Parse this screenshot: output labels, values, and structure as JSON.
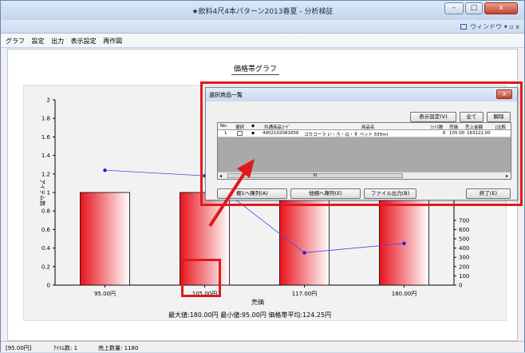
{
  "window": {
    "title": "★飲料4尺4本パターン2013春夏 - 分析検証",
    "buttons": [
      "–",
      "□",
      "x"
    ]
  },
  "mdi": {
    "window_menu": "ウィンドウ ▾  ▫  x"
  },
  "menu": {
    "items": [
      "グラフ",
      "設定",
      "出力",
      "表示設定",
      "再作図"
    ]
  },
  "chart_title": "価格帯グラフ",
  "chart_data": {
    "type": "bar",
    "categories": [
      "95.00円",
      "105.00円",
      "117.00円",
      "180.00円"
    ],
    "bar_series": {
      "name": "アイテム数",
      "values": [
        1,
        1,
        1,
        1
      ]
    },
    "line_series": {
      "name": "売上数量",
      "values": [
        1240,
        1180,
        350,
        450
      ]
    },
    "ylabel_left": "アイテム数",
    "ylim_left": [
      0,
      2
    ],
    "yticks_left": [
      "0",
      "0.2",
      "0.4",
      "0.6",
      "0.8",
      "1",
      "1.2",
      "1.4",
      "1.6",
      "1.8",
      "2"
    ],
    "ylim_right": [
      0,
      2000
    ],
    "yticks_right": [
      "0",
      "100",
      "200",
      "300",
      "400",
      "500",
      "600",
      "700"
    ],
    "xlabel": "売価",
    "colors": {
      "bar": "#e8121b",
      "line": "#4a4ae0"
    }
  },
  "stats_line": "最大値:180.00円  最小値:95.00円  価格帯平均:124.25円",
  "status": {
    "price": "[95.00円]",
    "items": "ｱｲﾃﾑ数: 1",
    "qty": "売上数量: 1180"
  },
  "dialog": {
    "title": "選択商品一覧",
    "close": "x",
    "top_buttons": [
      "表示設定(V)",
      "全て",
      "解除"
    ],
    "headers": [
      "No.",
      "選択",
      "◆",
      "共通商品ｺｰﾄﾞ",
      "商品名",
      "ﾌｪｲｽ数",
      "売価",
      "売上金額",
      "[比較"
    ],
    "rows": [
      [
        "1",
        "",
        "◆",
        "4902102081656",
        "コカコーラ い・ろ・は・す ペット 555ml",
        "6",
        "105.00",
        "163122.00",
        ""
      ]
    ],
    "scroll_thumb": "III",
    "bottom_buttons": [
      "棚1へ陳列(A)",
      "他棚へ陳列(E)",
      "ファイル出力(B)",
      "終了(E)"
    ]
  }
}
